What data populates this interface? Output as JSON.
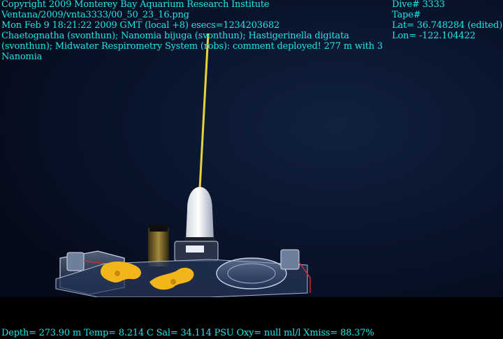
{
  "overlay": {
    "left_lines": [
      "Copyright 2009 Monterey Bay Aquarium Research Institute",
      "Ventana/2009/vnta3333/00_50_23_16.png",
      "Mon Feb  9 18:21:22 2009 GMT (local +8)  esecs=1234203682",
      "Chaetognatha (svonthun); Nanomia bijuga (svonthun); Hastigerinella digitata",
      "(svonthun); Midwater Respirometry System (robs): comment deployed! 277 m with 3",
      "Nanomia"
    ],
    "right_lines": [
      "Dive# 3333",
      "Tape#",
      "Lat= 36.748284 (edited)",
      "Lon= -122.104422"
    ],
    "bottom_line": "Depth= 273.90 m  Temp= 8.214 C  Sal= 34.114 PSU  Oxy= null ml/l  Xmiss= 88.37%"
  },
  "colors": {
    "overlay_text": "#1ee6e6",
    "water": "#0a1730",
    "tether": "#e8d23a",
    "sponge": "#f2b51a"
  }
}
